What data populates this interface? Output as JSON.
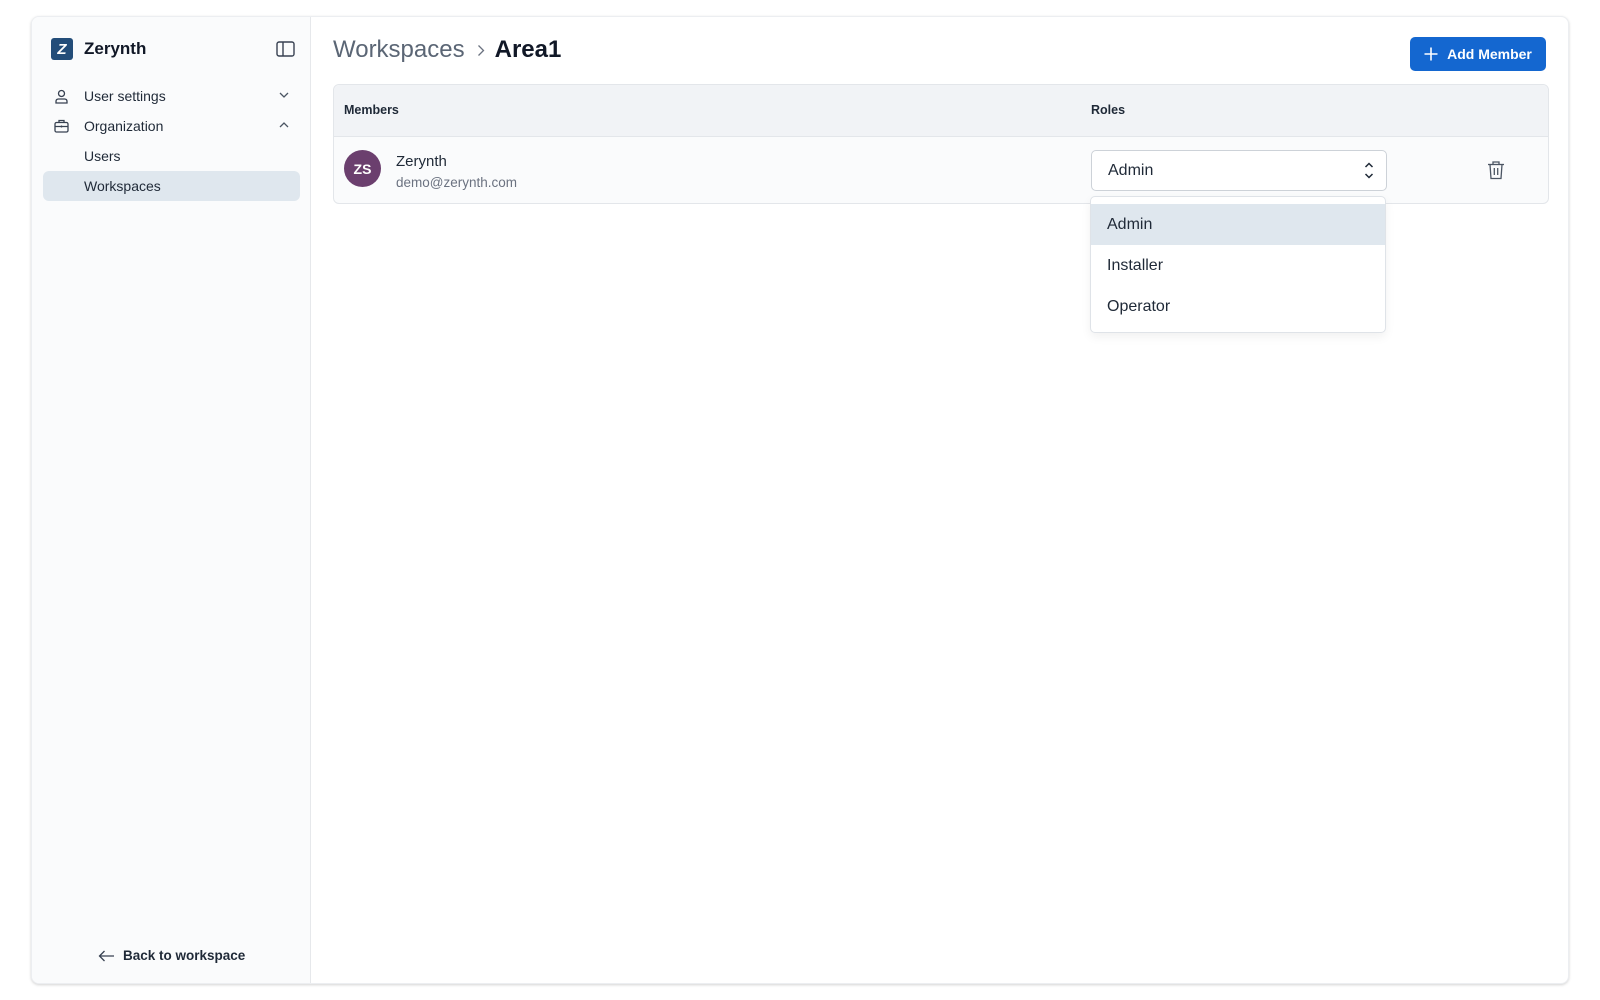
{
  "sidebar": {
    "brand": {
      "logo_glyph": "Z",
      "name": "Zerynth"
    },
    "items": [
      {
        "label": "User settings",
        "icon": "user-icon",
        "expanded": false
      },
      {
        "label": "Organization",
        "icon": "briefcase-icon",
        "expanded": true
      }
    ],
    "sub_items": [
      {
        "label": "Users",
        "active": false
      },
      {
        "label": "Workspaces",
        "active": true
      }
    ],
    "back_label": "Back to workspace"
  },
  "header": {
    "breadcrumb_parent": "Workspaces",
    "breadcrumb_current": "Area1",
    "add_button_label": "Add Member"
  },
  "table": {
    "columns": {
      "members": "Members",
      "roles": "Roles"
    },
    "rows": [
      {
        "initials": "ZS",
        "name": "Zerynth",
        "email": "demo@zerynth.com",
        "role": "Admin"
      }
    ]
  },
  "role_dropdown": {
    "open": true,
    "options": [
      "Admin",
      "Installer",
      "Operator"
    ],
    "selected": "Admin"
  },
  "colors": {
    "accent": "#1467d0",
    "brand": "#234d79",
    "avatar": "#6b3f6e",
    "active_bg": "#dfe7ee"
  }
}
